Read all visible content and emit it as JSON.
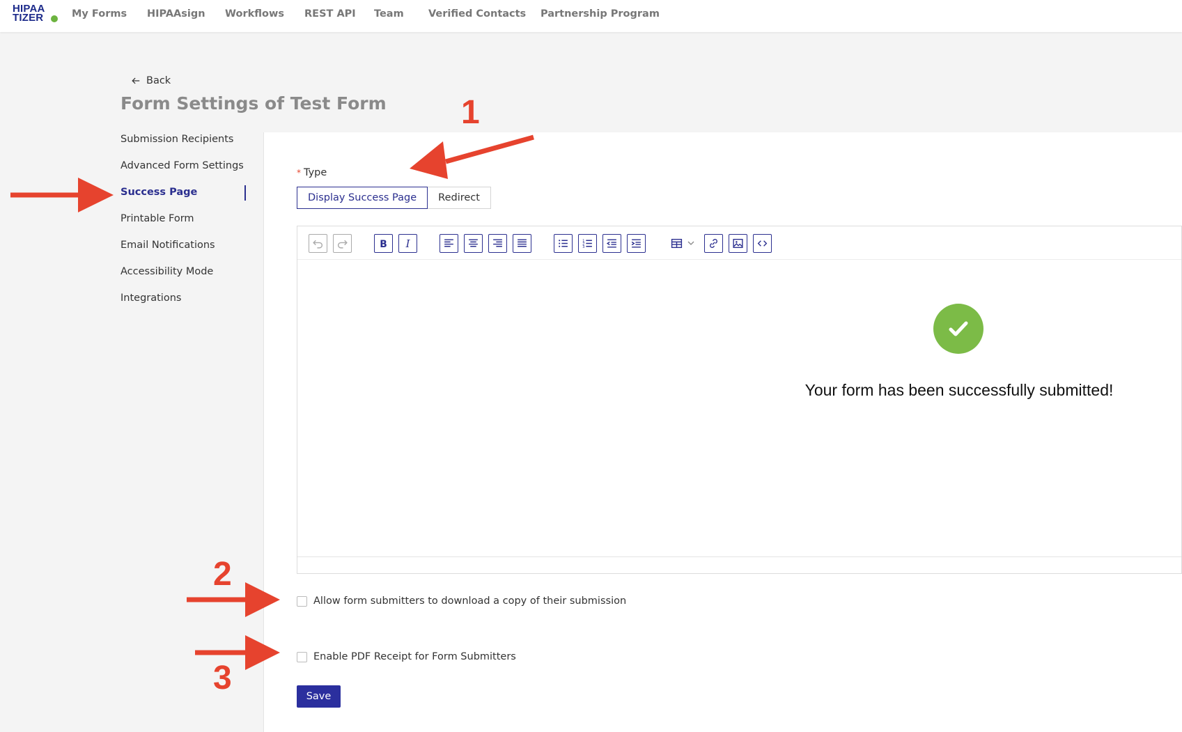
{
  "logo": {
    "line1": "HIPAA",
    "line2": "TIZER"
  },
  "nav": {
    "items": [
      {
        "label": "My Forms"
      },
      {
        "label": "HIPAAsign"
      },
      {
        "label": "Workflows"
      },
      {
        "label": "REST API"
      },
      {
        "label": "Team"
      },
      {
        "label": "Verified Contacts"
      },
      {
        "label": "Partnership Program"
      }
    ]
  },
  "header": {
    "back_label": "Back",
    "title": "Form Settings of Test Form"
  },
  "sidebar": {
    "items": [
      {
        "label": "Submission Recipients"
      },
      {
        "label": "Advanced Form Settings"
      },
      {
        "label": "Success Page",
        "active": true
      },
      {
        "label": "Printable Form"
      },
      {
        "label": "Email Notifications"
      },
      {
        "label": "Accessibility Mode"
      },
      {
        "label": "Integrations"
      }
    ]
  },
  "type_field": {
    "required_marker": "*",
    "label": "Type",
    "options": [
      "Display Success Page",
      "Redirect"
    ],
    "selected": "Display Success Page"
  },
  "editor": {
    "toolbar_icons": [
      "undo-icon",
      "redo-icon",
      "bold-icon",
      "italic-icon",
      "align-left-icon",
      "align-center-icon",
      "align-right-icon",
      "align-justify-icon",
      "bullet-list-icon",
      "numbered-list-icon",
      "outdent-icon",
      "indent-icon",
      "table-icon",
      "link-icon",
      "image-icon",
      "code-icon"
    ],
    "content_icon": "check-circle-icon",
    "content_text": "Your form has been successfully submitted!"
  },
  "options": {
    "allow_download_label": "Allow form submitters to download a copy of their submission",
    "allow_download_checked": false,
    "pdf_receipt_label": "Enable PDF Receipt for Form Submitters",
    "pdf_receipt_checked": false
  },
  "save_label": "Save",
  "annotations": {
    "n1": "1",
    "n2": "2",
    "n3": "3"
  },
  "colors": {
    "accent": "#2b2f9e",
    "annotation": "#e6432e",
    "success": "#7cbb47"
  }
}
